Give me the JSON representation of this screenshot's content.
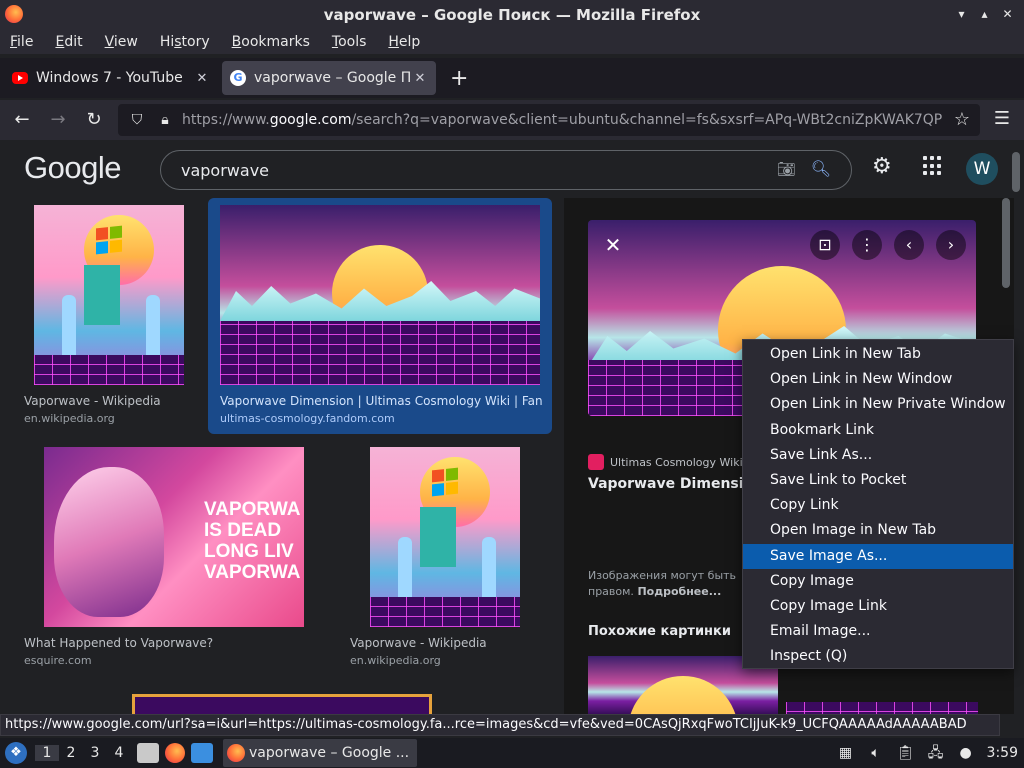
{
  "window": {
    "title": "vaporwave – Google Поиск — Mozilla Firefox"
  },
  "menu": [
    {
      "label": "File",
      "accel": "F",
      "rest": "ile"
    },
    {
      "label": "Edit",
      "accel": "E",
      "rest": "dit"
    },
    {
      "label": "View",
      "accel": "V",
      "rest": "iew"
    },
    {
      "label": "History",
      "accel": "s",
      "pre": "Hi",
      "rest": "tory"
    },
    {
      "label": "Bookmarks",
      "accel": "B",
      "rest": "ookmarks"
    },
    {
      "label": "Tools",
      "accel": "T",
      "rest": "ools"
    },
    {
      "label": "Help",
      "accel": "H",
      "rest": "elp"
    }
  ],
  "tabs": [
    {
      "label": "Windows 7 - YouTube",
      "icon": "youtube-icon"
    },
    {
      "label": "vaporwave – Google Пои",
      "icon": "google-icon"
    }
  ],
  "nav": {
    "url_prefix": "https://www.",
    "url_domain": "google.com",
    "url_rest": "/search?q=vaporwave&client=ubuntu&channel=fs&sxsrf=APq-WBt2cniZpKWAK7QP"
  },
  "google": {
    "logo": "Google",
    "query": "vaporwave",
    "avatar": "W"
  },
  "results": [
    {
      "title": "Vaporwave - Wikipedia",
      "source": "en.wikipedia.org"
    },
    {
      "title": "Vaporwave Dimension | Ultimas Cosmology Wiki | Fando...",
      "source": "ultimas-cosmology.fandom.com"
    },
    {
      "title": "What Happened to Vaporwave?",
      "source": "esquire.com"
    },
    {
      "title": "Vaporwave - Wikipedia",
      "source": "en.wikipedia.org"
    }
  ],
  "david_text": [
    "VAPORWA",
    "IS DEAD",
    "LONG LIV",
    "VAPORWA"
  ],
  "preview": {
    "source": "Ultimas Cosmology Wiki -",
    "title": "Vaporwave Dimension",
    "note": "Изображения могут быть",
    "note2": "правом.",
    "note_more": "Подробнее...",
    "similar": "Похожие картинки"
  },
  "context_menu": [
    "Open Link in New Tab",
    "Open Link in New Window",
    "Open Link in New Private Window",
    "Bookmark Link",
    "Save Link As...",
    "Save Link to Pocket",
    "Copy Link",
    "Open Image in New Tab",
    "Save Image As...",
    "Copy Image",
    "Copy Image Link",
    "Email Image...",
    "Inspect (Q)"
  ],
  "status_url": "https://www.google.com/url?sa=i&url=https://ultimas-cosmology.fa...rce=images&cd=vfe&ved=0CAsQjRxqFwoTCIjJuK-k9_UCFQAAAAAdAAAAABAD",
  "taskbar": {
    "workspaces": [
      "1",
      "2",
      "3",
      "4"
    ],
    "window_label": "vaporwave – Google ...",
    "clock": "3:59"
  },
  "colors": {
    "accent": "#0b5cad",
    "selected_card": "#1a4a8a",
    "link": "#8ab4f8"
  }
}
